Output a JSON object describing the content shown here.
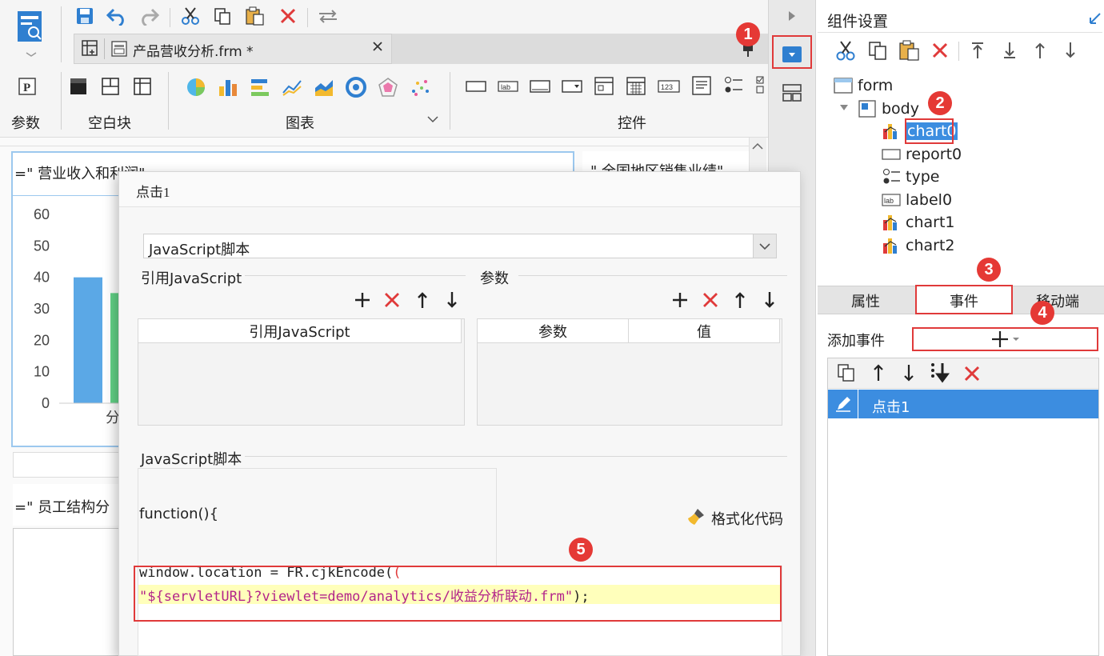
{
  "toolbar": {
    "tab_title": "产品营收分析.frm *",
    "ribbon_groups": [
      "参数",
      "空白块",
      "图表",
      "控件"
    ]
  },
  "canvas": {
    "title1": "=\"  营业收入和利润\"",
    "title2": "\"  全国地区销售业绩\"",
    "title3": "=\"  员工结构分",
    "chart_axis_label": "分",
    "y_ticks": [
      "60",
      "50",
      "40",
      "30",
      "20",
      "10",
      "0"
    ]
  },
  "chart_data": {
    "type": "bar",
    "categories": [
      "分"
    ],
    "series": [
      {
        "values": [
          40
        ]
      },
      {
        "values": [
          35
        ]
      }
    ],
    "ylim": [
      0,
      60
    ],
    "yticks": [
      0,
      10,
      20,
      30,
      40,
      50,
      60
    ]
  },
  "dialog": {
    "title": "点击1",
    "type_select": "JavaScript脚本",
    "ref_js_section": "引用JavaScript",
    "params_section": "参数",
    "ref_js_col": "引用JavaScript",
    "param_col": "参数",
    "value_col": "值",
    "script_section": "JavaScript脚本",
    "func_decl": "function(){",
    "format_code": "格式化代码",
    "code_line1": "window.location = FR.cjkEncode(",
    "code_line2_str": "\"${servletURL}?viewlet=demo/analytics/收益分析联动.frm\"",
    "code_line2_end": ");"
  },
  "panel": {
    "title": "组件设置",
    "tree": {
      "form": "form",
      "body": "body",
      "children": [
        "chart0",
        "report0",
        "type",
        "label0",
        "chart1",
        "chart2"
      ]
    },
    "tabs": [
      "属性",
      "事件",
      "移动端"
    ],
    "add_event": "添加事件",
    "events": [
      "点击1"
    ]
  },
  "badges": [
    "1",
    "2",
    "3",
    "4",
    "5"
  ],
  "colors": {
    "accent": "#3c8de0",
    "annotation": "#e03a3a",
    "selected_row": "#3c8de0",
    "code_highlight": "#ffffbb",
    "bar_blue": "#5ba8e6",
    "bar_green": "#62d387"
  }
}
